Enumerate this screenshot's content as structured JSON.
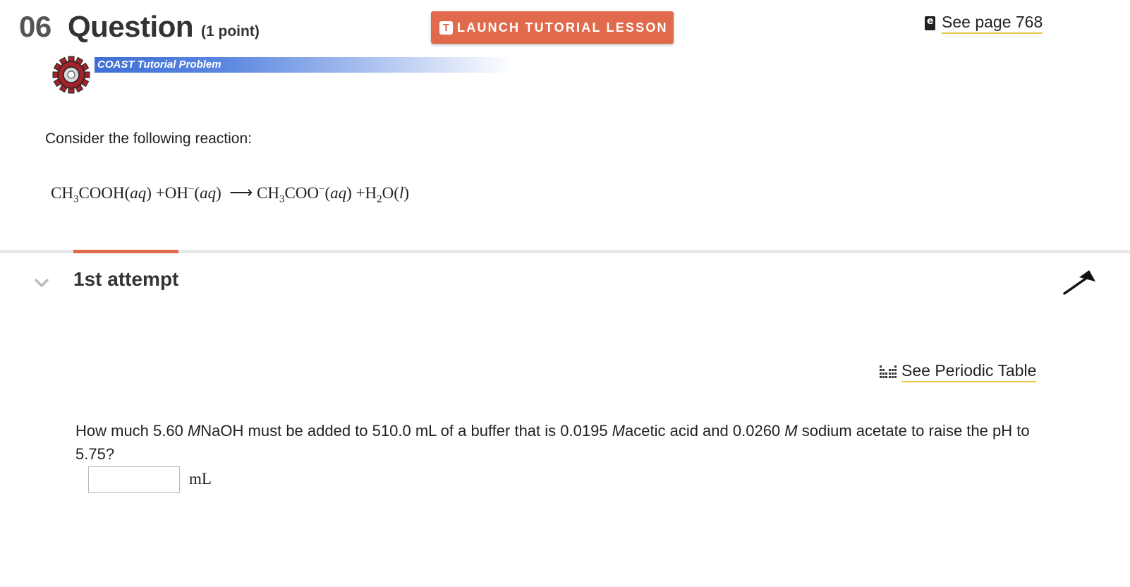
{
  "header": {
    "question_number": "06",
    "question_word": "Question",
    "points": "(1 point)",
    "launch_button": "LAUNCH TUTORIAL LESSON",
    "launch_icon_letter": "T",
    "see_page": "See page 768"
  },
  "tutorial": {
    "banner_text": "COAST Tutorial Problem"
  },
  "problem": {
    "intro": "Consider the following reaction:",
    "reaction": {
      "reactant1": {
        "pre": "CH",
        "sub": "3",
        "post": "COOH(",
        "phase": "aq",
        "close": ")"
      },
      "plus1": "+",
      "reactant2": {
        "pre": "OH",
        "sup": "−",
        "open": "(",
        "phase": "aq",
        "close": ")"
      },
      "arrow": "⟶",
      "product1": {
        "pre": "CH",
        "sub": "3",
        "post": "COO",
        "sup": "−",
        "open": "(",
        "phase": "aq",
        "close": ")"
      },
      "plus2": "+",
      "product2": {
        "pre": "H",
        "sub": "2",
        "post": "O(",
        "phase": "l",
        "close": ")"
      }
    }
  },
  "attempt": {
    "title": "1st attempt",
    "periodic_table": "See Periodic Table",
    "question": {
      "p1": "How much 5.60 ",
      "m1": "M",
      "p2": "NaOH must be added to 510.0 mL of a buffer that is 0.0195 ",
      "m2": "M",
      "p3": "acetic acid and 0.0260 ",
      "m3": "M",
      "p4": " sodium acetate to raise the pH to 5.75?"
    },
    "answer_value": "",
    "unit": "mL"
  },
  "colors": {
    "accent": "#e06a4b",
    "link_underline": "#e8c44a",
    "banner_blue": "#3f6fd6",
    "gear_red": "#a3232b"
  }
}
